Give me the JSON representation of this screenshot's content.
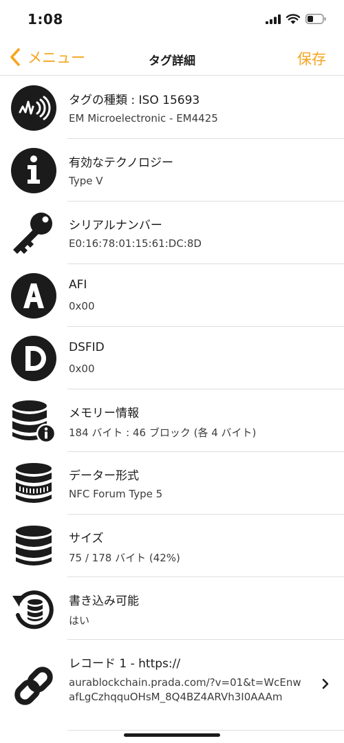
{
  "status_bar": {
    "time": "1:08"
  },
  "nav": {
    "back_label": "メニュー",
    "title": "タグ詳細",
    "save_label": "保存"
  },
  "colors": {
    "accent": "#f5a51f",
    "text": "#1b1b1b",
    "secondary_text": "#3c3c3c",
    "separator": "#dedede"
  },
  "rows": [
    {
      "icon": "nfc-signal-icon",
      "title": "タグの種類 : ISO 15693",
      "value": "EM Microelectronic - EM4425"
    },
    {
      "icon": "info-icon",
      "title": "有効なテクノロジー",
      "value": "Type V"
    },
    {
      "icon": "key-icon",
      "title": "シリアルナンバー",
      "value": "E0:16:78:01:15:61:DC:8D"
    },
    {
      "icon": "letter-a-icon",
      "title": "AFI",
      "value": "0x00"
    },
    {
      "icon": "letter-d-icon",
      "title": "DSFID",
      "value": "0x00"
    },
    {
      "icon": "database-info-icon",
      "title": "メモリー情報",
      "value": "184 バイト : 46 ブロック (各 4 バイト)"
    },
    {
      "icon": "database-format-icon",
      "title": "データー形式",
      "value": "NFC Forum Type 5"
    },
    {
      "icon": "database-icon",
      "title": "サイズ",
      "value": "75 / 178 バイト (42%)"
    },
    {
      "icon": "database-rewrite-icon",
      "title": "書き込み可能",
      "value": "はい"
    }
  ],
  "record": {
    "icon": "link-icon",
    "title": "レコード 1 - https://",
    "value": "aurablockchain.prada.com/?v=01&t=WcEnwafLgCzhqquOHsM_8Q4BZ4ARVh3I0AAAm",
    "chevron_icon": "chevron-right-icon"
  }
}
